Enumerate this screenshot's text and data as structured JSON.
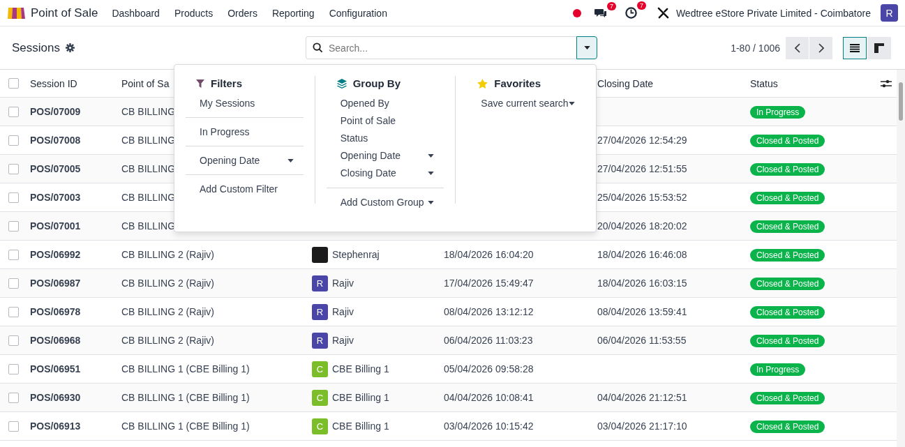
{
  "navbar": {
    "app_name": "Point of Sale",
    "menu": [
      "Dashboard",
      "Products",
      "Orders",
      "Reporting",
      "Configuration"
    ],
    "messages_badge": "7",
    "activities_badge": "7",
    "company": "Wedtree eStore Private Limited - Coimbatore",
    "user_initial": "R"
  },
  "control_panel": {
    "title": "Sessions",
    "search": {
      "placeholder": "Search..."
    },
    "pager": "1-80 / 1006",
    "views": [
      {
        "kind": "list",
        "selected": true
      },
      {
        "kind": "kanban",
        "selected": false
      }
    ]
  },
  "search_panel": {
    "filters": {
      "title": "Filters",
      "groups": [
        [
          {
            "label": "My Sessions",
            "kind": "option"
          }
        ],
        [
          {
            "label": "In Progress",
            "kind": "option"
          }
        ],
        [
          {
            "label": "Opening Date",
            "kind": "dropdown"
          }
        ],
        [
          {
            "label": "Add Custom Filter",
            "kind": "option"
          }
        ]
      ]
    },
    "group_by": {
      "title": "Group By",
      "groups": [
        [
          {
            "label": "Opened By",
            "kind": "option"
          },
          {
            "label": "Point of Sale",
            "kind": "option"
          },
          {
            "label": "Status",
            "kind": "option"
          },
          {
            "label": "Opening Date",
            "kind": "dropdown"
          },
          {
            "label": "Closing Date",
            "kind": "dropdown"
          }
        ],
        [
          {
            "label": "Add Custom Group",
            "kind": "dropdown"
          }
        ]
      ]
    },
    "favorites": {
      "title": "Favorites",
      "items": [
        {
          "label": "Save current search",
          "kind": "dropdown"
        }
      ]
    }
  },
  "table": {
    "select_all_checked": false,
    "columns": {
      "session_id": "Session ID",
      "point_of_sale": "Point of Sa",
      "closing_date": "Closing Date",
      "status": "Status"
    },
    "rows": [
      {
        "checked": false,
        "session_id": "POS/07009",
        "point_of_sale": "CB BILLING",
        "status": "In Progress"
      },
      {
        "checked": false,
        "session_id": "POS/07008",
        "point_of_sale": "CB BILLING",
        "closing_date": "27/04/2026 12:54:29",
        "status": "Closed & Posted"
      },
      {
        "checked": false,
        "session_id": "POS/07005",
        "point_of_sale": "CB BILLING",
        "closing_date": "27/04/2026 12:51:55",
        "status": "Closed & Posted"
      },
      {
        "checked": false,
        "session_id": "POS/07003",
        "point_of_sale": "CB BILLING",
        "closing_date": "25/04/2026 15:53:52",
        "status": "Closed & Posted"
      },
      {
        "checked": false,
        "session_id": "POS/07001",
        "point_of_sale": "CB BILLING",
        "closing_date": "20/04/2026 18:20:02",
        "status": "Closed & Posted"
      },
      {
        "checked": false,
        "session_id": "POS/06992",
        "point_of_sale": "CB BILLING 2 (Rajiv)",
        "opened_by": {
          "name": "Stephenraj",
          "kind": "image"
        },
        "opening_date": "18/04/2026 16:04:20",
        "closing_date": "18/04/2026 16:46:08",
        "status": "Closed & Posted"
      },
      {
        "checked": false,
        "session_id": "POS/06987",
        "point_of_sale": "CB BILLING 2 (Rajiv)",
        "opened_by": {
          "name": "Rajiv",
          "kind": "letter",
          "initial": "R",
          "color": "#4a46a8"
        },
        "opening_date": "17/04/2026 15:49:47",
        "closing_date": "18/04/2026 16:03:15",
        "status": "Closed & Posted"
      },
      {
        "checked": false,
        "session_id": "POS/06978",
        "point_of_sale": "CB BILLING 2 (Rajiv)",
        "opened_by": {
          "name": "Rajiv",
          "kind": "letter",
          "initial": "R",
          "color": "#4a46a8"
        },
        "opening_date": "08/04/2026 13:12:12",
        "closing_date": "08/04/2026 13:59:41",
        "status": "Closed & Posted"
      },
      {
        "checked": false,
        "session_id": "POS/06968",
        "point_of_sale": "CB BILLING 2 (Rajiv)",
        "opened_by": {
          "name": "Rajiv",
          "kind": "letter",
          "initial": "R",
          "color": "#4a46a8"
        },
        "opening_date": "06/04/2026 11:03:23",
        "closing_date": "06/04/2026 11:53:55",
        "status": "Closed & Posted"
      },
      {
        "checked": false,
        "session_id": "POS/06951",
        "point_of_sale": "CB BILLING 1 (CBE Billing 1)",
        "opened_by": {
          "name": "CBE Billing 1",
          "kind": "letter",
          "initial": "C",
          "color": "#7cbd2a"
        },
        "opening_date": "05/04/2026 09:58:28",
        "status": "In Progress"
      },
      {
        "checked": false,
        "session_id": "POS/06930",
        "point_of_sale": "CB BILLING 1 (CBE Billing 1)",
        "opened_by": {
          "name": "CBE Billing 1",
          "kind": "letter",
          "initial": "C",
          "color": "#7cbd2a"
        },
        "opening_date": "04/04/2026 10:08:41",
        "closing_date": "04/04/2026 21:12:51",
        "status": "Closed & Posted"
      },
      {
        "checked": false,
        "session_id": "POS/06913",
        "point_of_sale": "CB BILLING 1 (CBE Billing 1)",
        "opened_by": {
          "name": "CBE Billing 1",
          "kind": "letter",
          "initial": "C",
          "color": "#7cbd2a"
        },
        "opening_date": "03/04/2026 10:15:42",
        "closing_date": "03/04/2026 21:17:10",
        "status": "Closed & Posted"
      }
    ]
  }
}
